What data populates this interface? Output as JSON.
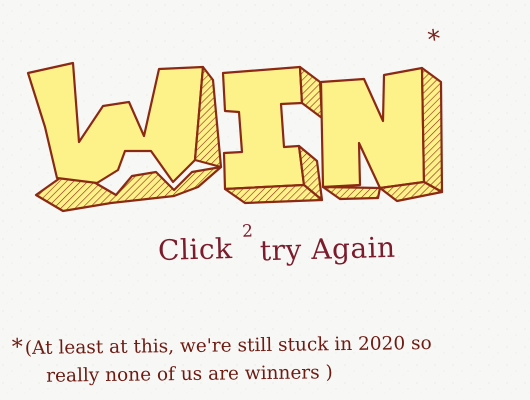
{
  "title": {
    "text": "WIN",
    "asterisk": "*",
    "fill_color": "#fdf18a",
    "outline_color": "#8b2a14"
  },
  "retry": {
    "click": "Click",
    "superscript": "2",
    "rest": "try Again",
    "color": "#7b1b2b"
  },
  "disclaimer": {
    "star": "*",
    "line1": "(At least at this, we're still stuck in 2020 so",
    "line2": "really none of us are winners )",
    "color": "#6d1b12"
  }
}
